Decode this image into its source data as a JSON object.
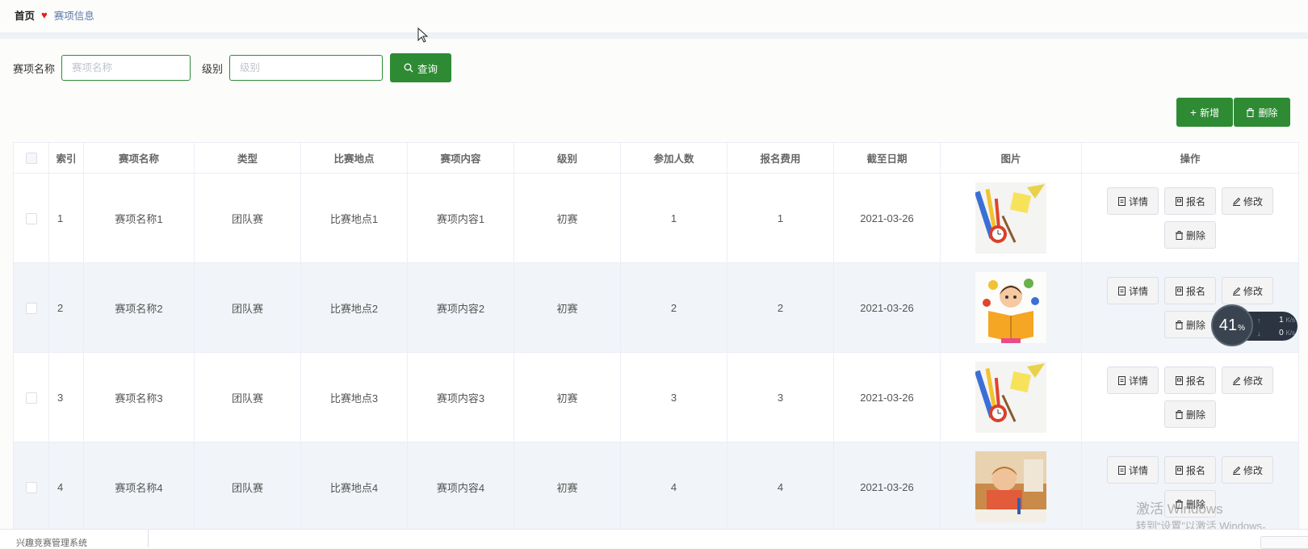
{
  "breadcrumb": {
    "home": "首页",
    "current": "赛项信息"
  },
  "search": {
    "name_label": "赛项名称",
    "name_placeholder": "赛项名称",
    "level_label": "级别",
    "level_placeholder": "级别",
    "query_button": "查询"
  },
  "toolbar": {
    "add_label": "新增",
    "delete_label": "删除"
  },
  "table": {
    "headers": [
      "索引",
      "赛项名称",
      "类型",
      "比赛地点",
      "赛项内容",
      "级别",
      "参加人数",
      "报名费用",
      "截至日期",
      "图片",
      "操作"
    ],
    "rows": [
      {
        "index": "1",
        "name": "赛项名称1",
        "type": "团队赛",
        "location": "比赛地点1",
        "content": "赛项内容1",
        "level": "初赛",
        "participants": "1",
        "fee": "1",
        "deadline": "2021-03-26",
        "image": "stationery-clipart"
      },
      {
        "index": "2",
        "name": "赛项名称2",
        "type": "团队赛",
        "location": "比赛地点2",
        "content": "赛项内容2",
        "level": "初赛",
        "participants": "2",
        "fee": "2",
        "deadline": "2021-03-26",
        "image": "girl-reading-book-clipart"
      },
      {
        "index": "3",
        "name": "赛项名称3",
        "type": "团队赛",
        "location": "比赛地点3",
        "content": "赛项内容3",
        "level": "初赛",
        "participants": "3",
        "fee": "3",
        "deadline": "2021-03-26",
        "image": "stationery-clipart"
      },
      {
        "index": "4",
        "name": "赛项名称4",
        "type": "团队赛",
        "location": "比赛地点4",
        "content": "赛项内容4",
        "level": "初赛",
        "participants": "4",
        "fee": "4",
        "deadline": "2021-03-26",
        "image": "student-classroom-photo"
      }
    ],
    "row_actions": {
      "detail": "详情",
      "signup": "报名",
      "edit": "修改",
      "delete": "删除"
    }
  },
  "network_widget": {
    "percent": "41",
    "percent_unit": "%",
    "upload": "1",
    "download": "0",
    "unit": "K/s"
  },
  "watermark": {
    "line1": "激活 Windows",
    "line2": "转到“设置”以激活 Windows。"
  },
  "taskbar": {
    "item_text": "兴趣竞赛管理系统"
  },
  "colors": {
    "primary": "#2e8b34",
    "heart": "#e02020",
    "link": "#5a7aa8",
    "row_alt": "#f1f4f8"
  }
}
